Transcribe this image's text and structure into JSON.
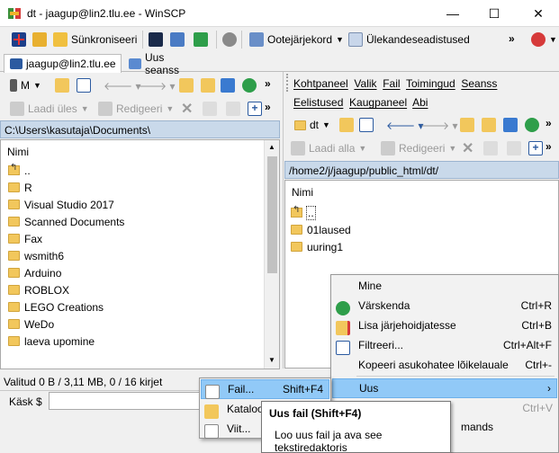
{
  "window": {
    "title": "dt - jaagup@lin2.tlu.ee - WinSCP"
  },
  "toolbar": {
    "sync_label": "Sünkroniseeri",
    "queue_label": "Ootejärjekord",
    "transfer_settings_label": "Ülekandeseadistused",
    "more": "»"
  },
  "tabs": {
    "session": "jaagup@lin2.tlu.ee",
    "new_session": "Uus seanss"
  },
  "left": {
    "drive": "M",
    "upload_label": "Laadi üles",
    "edit_label": "Redigeeri",
    "path": "C:\\Users\\kasutaja\\Documents\\",
    "column_name": "Nimi",
    "files": [
      "..",
      "R",
      "Visual Studio 2017",
      "Scanned Documents",
      "Fax",
      "wsmith6",
      "Arduino",
      "ROBLOX",
      "LEGO Creations",
      "WeDo",
      "laeva upomine"
    ],
    "status": "Valitud 0 B / 3,11 MB, 0 / 16 kirjet",
    "command_label": "Käsk $"
  },
  "right": {
    "menubar": [
      "Kohtpaneel",
      "Valik",
      "Fail",
      "Toimingud",
      "Seanss",
      "Eelistused",
      "Kaugpaneel",
      "Abi"
    ],
    "drive": "dt",
    "download_label": "Laadi alla",
    "edit_label": "Redigeeri",
    "path": "/home2/j/jaagup/public_html/dt/",
    "column_name": "Nimi",
    "files": [
      "..",
      "01laused",
      "uuring1"
    ]
  },
  "context_menu": {
    "items": [
      {
        "label": "Mine",
        "shortcut": ""
      },
      {
        "label": "Värskenda",
        "shortcut": "Ctrl+R"
      },
      {
        "label": "Lisa järjehoidjatesse",
        "shortcut": "Ctrl+B"
      },
      {
        "label": "Filtreeri...",
        "shortcut": "Ctrl+Alt+F"
      },
      {
        "label": "Kopeeri asukohatee lõikelauale",
        "shortcut": "Ctrl+-"
      },
      {
        "label": "Uus",
        "shortcut": ""
      }
    ],
    "partial_shortcut": "Ctrl+V",
    "partial_text": "mands"
  },
  "submenu": {
    "items": [
      {
        "label": "Fail...",
        "shortcut": "Shift+F4"
      },
      {
        "label": "Kataloo",
        "shortcut": ""
      },
      {
        "label": "Viit...",
        "shortcut": ""
      }
    ]
  },
  "tooltip": {
    "title": "Uus fail (Shift+F4)",
    "body": "Loo uus fail ja ava see tekstiredaktoris"
  }
}
